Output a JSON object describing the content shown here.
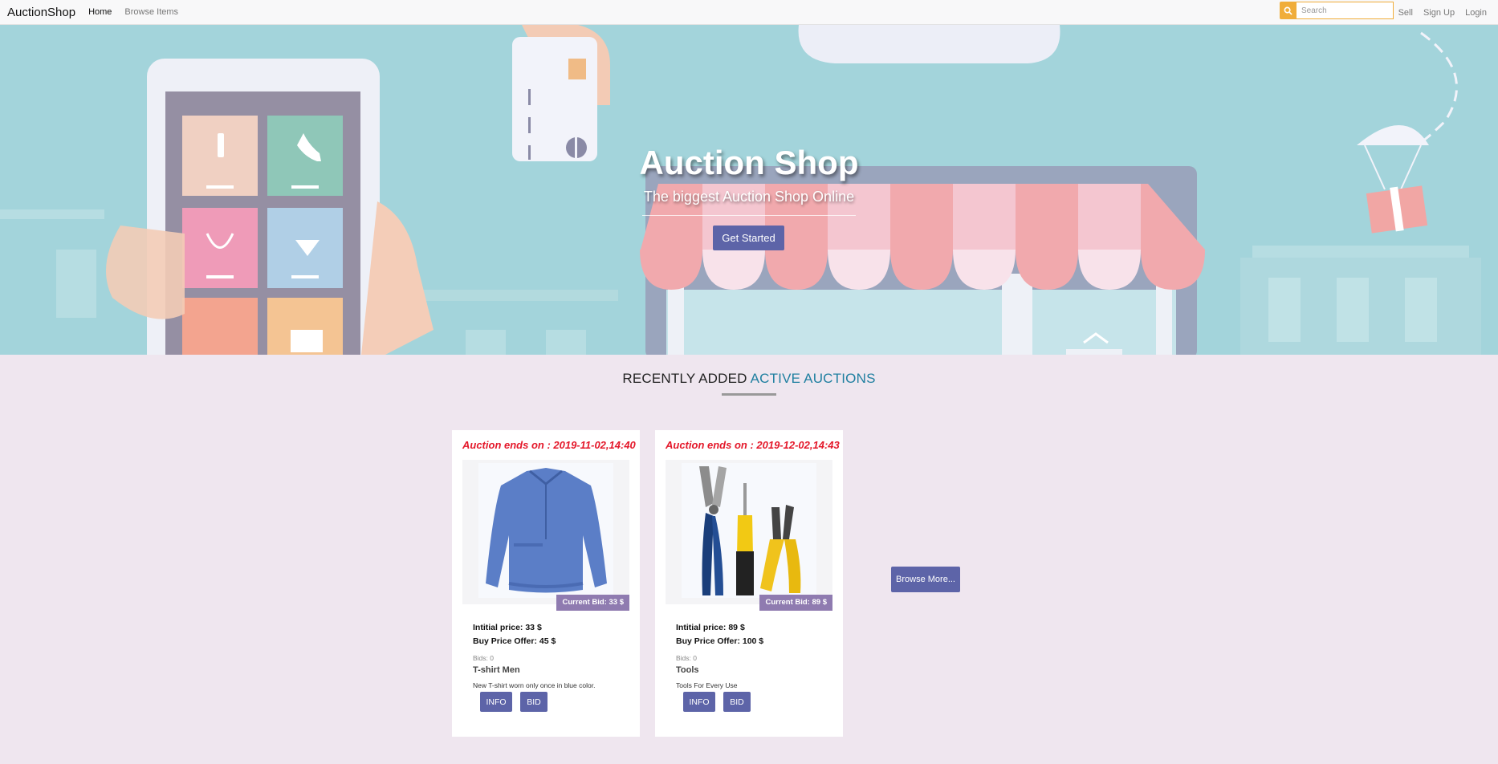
{
  "navbar": {
    "brand": "AuctionShop",
    "links": [
      "Home",
      "Browse Items"
    ],
    "search_placeholder": "Search",
    "right_links": [
      "Sell",
      "Sign Up",
      "Login"
    ]
  },
  "hero": {
    "title": "Auction Shop",
    "subtitle": "The biggest Auction Shop Online",
    "button": "Get Started"
  },
  "section": {
    "title_prefix": "RECENTLY ADDED ",
    "title_accent": "ACTIVE AUCTIONS"
  },
  "auctions": [
    {
      "ends": "Auction ends on : 2019-11-02,14:40",
      "current_bid": "Current Bid: 33 $",
      "initial_price": "Intitial price: 33 $",
      "buy_price": "Buy Price Offer: 45 $",
      "bids": "Bids: 0",
      "name": "T-shirt Men",
      "description": "New T-shirt worn only once in blue color.",
      "info_label": "INFO",
      "bid_label": "BID",
      "image_icon": "blue-shirt-image"
    },
    {
      "ends": "Auction ends on : 2019-12-02,14:43",
      "current_bid": "Current Bid: 89 $",
      "initial_price": "Intitial price: 89 $",
      "buy_price": "Buy Price Offer: 100 $",
      "bids": "Bids: 0",
      "name": "Tools",
      "description": "Tools For Every Use",
      "info_label": "INFO",
      "bid_label": "BID",
      "image_icon": "tools-image"
    }
  ],
  "browse_more": "Browse More...",
  "colors": {
    "accent": "#1f7fa0",
    "button": "#5d64a8",
    "badge": "#8f7bb0",
    "ends_red": "#e4182a",
    "search_orange": "#f0ad3a"
  }
}
